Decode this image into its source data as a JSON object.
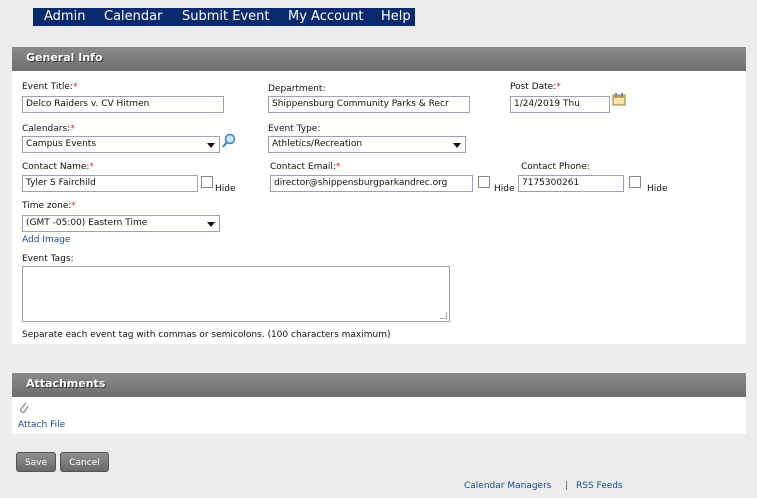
{
  "nav": {
    "items": [
      "Admin",
      "Calendar",
      "Submit Event",
      "My Account",
      "Help"
    ]
  },
  "general": {
    "section_title": "General Info",
    "event_title": {
      "label": "Event Title:",
      "req": "*",
      "value": "Delco Raiders v. CV Hitmen"
    },
    "department": {
      "label": "Department:",
      "value": "Shippensburg Community Parks & Recr"
    },
    "post_date": {
      "label": "Post Date:",
      "req": "*",
      "value": "1/24/2019 Thu"
    },
    "calendars": {
      "label": "Calendars:",
      "req": "*",
      "value": "Campus Events"
    },
    "event_type": {
      "label": "Event Type:",
      "value": "Athletics/Recreation"
    },
    "contact_name": {
      "label": "Contact Name:",
      "req": "*",
      "value": "Tyler S Fairchild"
    },
    "contact_email": {
      "label": "Contact Email:",
      "req": "*",
      "value": "director@shippensburgparkandrec.org"
    },
    "contact_phone": {
      "label": "Contact Phone:",
      "value": "7175300261"
    },
    "hide_label": "Hide",
    "time_zone": {
      "label": "Time zone:",
      "req": "*",
      "value": "(GMT -05:00) Eastern Time"
    },
    "add_image": "Add Image",
    "event_tags": {
      "label": "Event Tags:",
      "value": ""
    },
    "tags_hint": "Separate each event tag with commas or semicolons. (100 characters maximum)"
  },
  "attachments": {
    "section_title": "Attachments",
    "attach_file": "Attach File"
  },
  "buttons": {
    "save": "Save",
    "cancel": "Cancel"
  },
  "footer": {
    "calendar_managers": "Calendar Managers",
    "separator": "|",
    "rss_feeds": "RSS Feeds"
  },
  "icons": [
    "calendar-icon",
    "search-icon",
    "paperclip-icon"
  ]
}
